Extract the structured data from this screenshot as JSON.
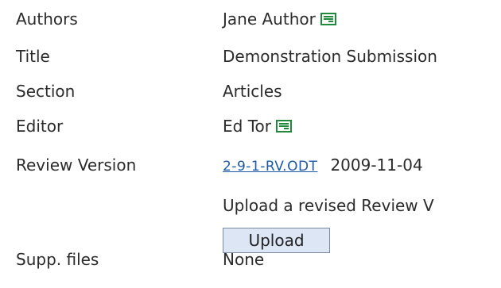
{
  "rows": {
    "authors": {
      "label": "Authors",
      "value": "Jane Author"
    },
    "title": {
      "label": "Title",
      "value": "Demonstration Submission"
    },
    "section": {
      "label": "Section",
      "value": "Articles"
    },
    "editor": {
      "label": "Editor",
      "value": "Ed Tor"
    },
    "review_version": {
      "label": "Review Version",
      "file_link": "2-9-1-RV.ODT",
      "date": "2009-11-04"
    },
    "upload_text": "Upload a revised Review V",
    "upload_button": "Upload",
    "supp_files": {
      "label": "Supp. files",
      "value": "None"
    }
  },
  "icons": {
    "email": "email-icon"
  },
  "colors": {
    "link": "#1c5aa8",
    "icon": "#1e8a3a",
    "button_bg": "#dde6f4"
  }
}
